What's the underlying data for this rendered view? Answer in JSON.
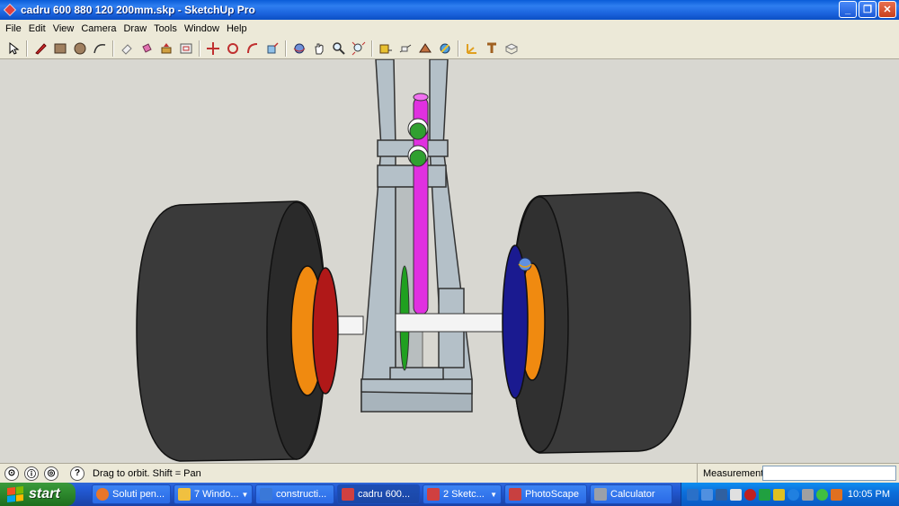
{
  "window": {
    "title": "cadru 600 880 120 200mm.skp - SketchUp Pro",
    "buttons": [
      "_",
      "❐",
      "✕"
    ]
  },
  "menu": [
    "File",
    "Edit",
    "View",
    "Camera",
    "Draw",
    "Tools",
    "Window",
    "Help"
  ],
  "toolbar": {
    "groups": [
      [
        "select-icon"
      ],
      [
        "pencil-icon",
        "rectangle-icon",
        "circle-icon",
        "arc-icon"
      ],
      [
        "eraser-icon",
        "paint-bucket-icon",
        "push-pull-icon",
        "offset-icon"
      ],
      [
        "move-icon",
        "rotate-icon",
        "follow-me-icon",
        "scale-icon"
      ],
      [
        "orbit-icon",
        "pan-icon",
        "zoom-icon",
        "zoom-extents-icon"
      ],
      [
        "tape-measure-icon",
        "dimension-icon",
        "protractor-icon",
        "text-icon"
      ],
      [
        "axes-icon",
        "3d-text-icon",
        "section-plane-icon"
      ]
    ]
  },
  "statusbar": {
    "hint": "Drag to orbit.  Shift = Pan",
    "measurements_label": "Measurements",
    "measurements_value": ""
  },
  "taskbar": {
    "start_label": "start",
    "tasks": [
      {
        "label": "Soluti pen...",
        "color": "#e8762a",
        "active": false,
        "dropdown": false
      },
      {
        "label": "7 Windo...",
        "color": "#f0c040",
        "active": false,
        "dropdown": true
      },
      {
        "label": "constructi...",
        "color": "#3a78d8",
        "active": false,
        "dropdown": false
      },
      {
        "label": "cadru 600...",
        "color": "#d04040",
        "active": true,
        "dropdown": false
      },
      {
        "label": "2 Sketc...",
        "color": "#d04040",
        "active": false,
        "dropdown": true
      },
      {
        "label": "PhotoScape",
        "color": "#c84040",
        "active": false,
        "dropdown": false
      },
      {
        "label": "Calculator",
        "color": "#9aa0a8",
        "active": false,
        "dropdown": false
      }
    ],
    "clock": "10:05 PM"
  },
  "colors": {
    "tire": "#3a3a3a",
    "frame": "#b4c0c8",
    "shaft": "#e030e0",
    "pulley_left": "#f08a10",
    "disc_left": "#b01818",
    "disc_right": "#1a1a90",
    "sprocket": "#20a020",
    "axle": "#f4f4f4",
    "background": "#d8d7d1"
  }
}
